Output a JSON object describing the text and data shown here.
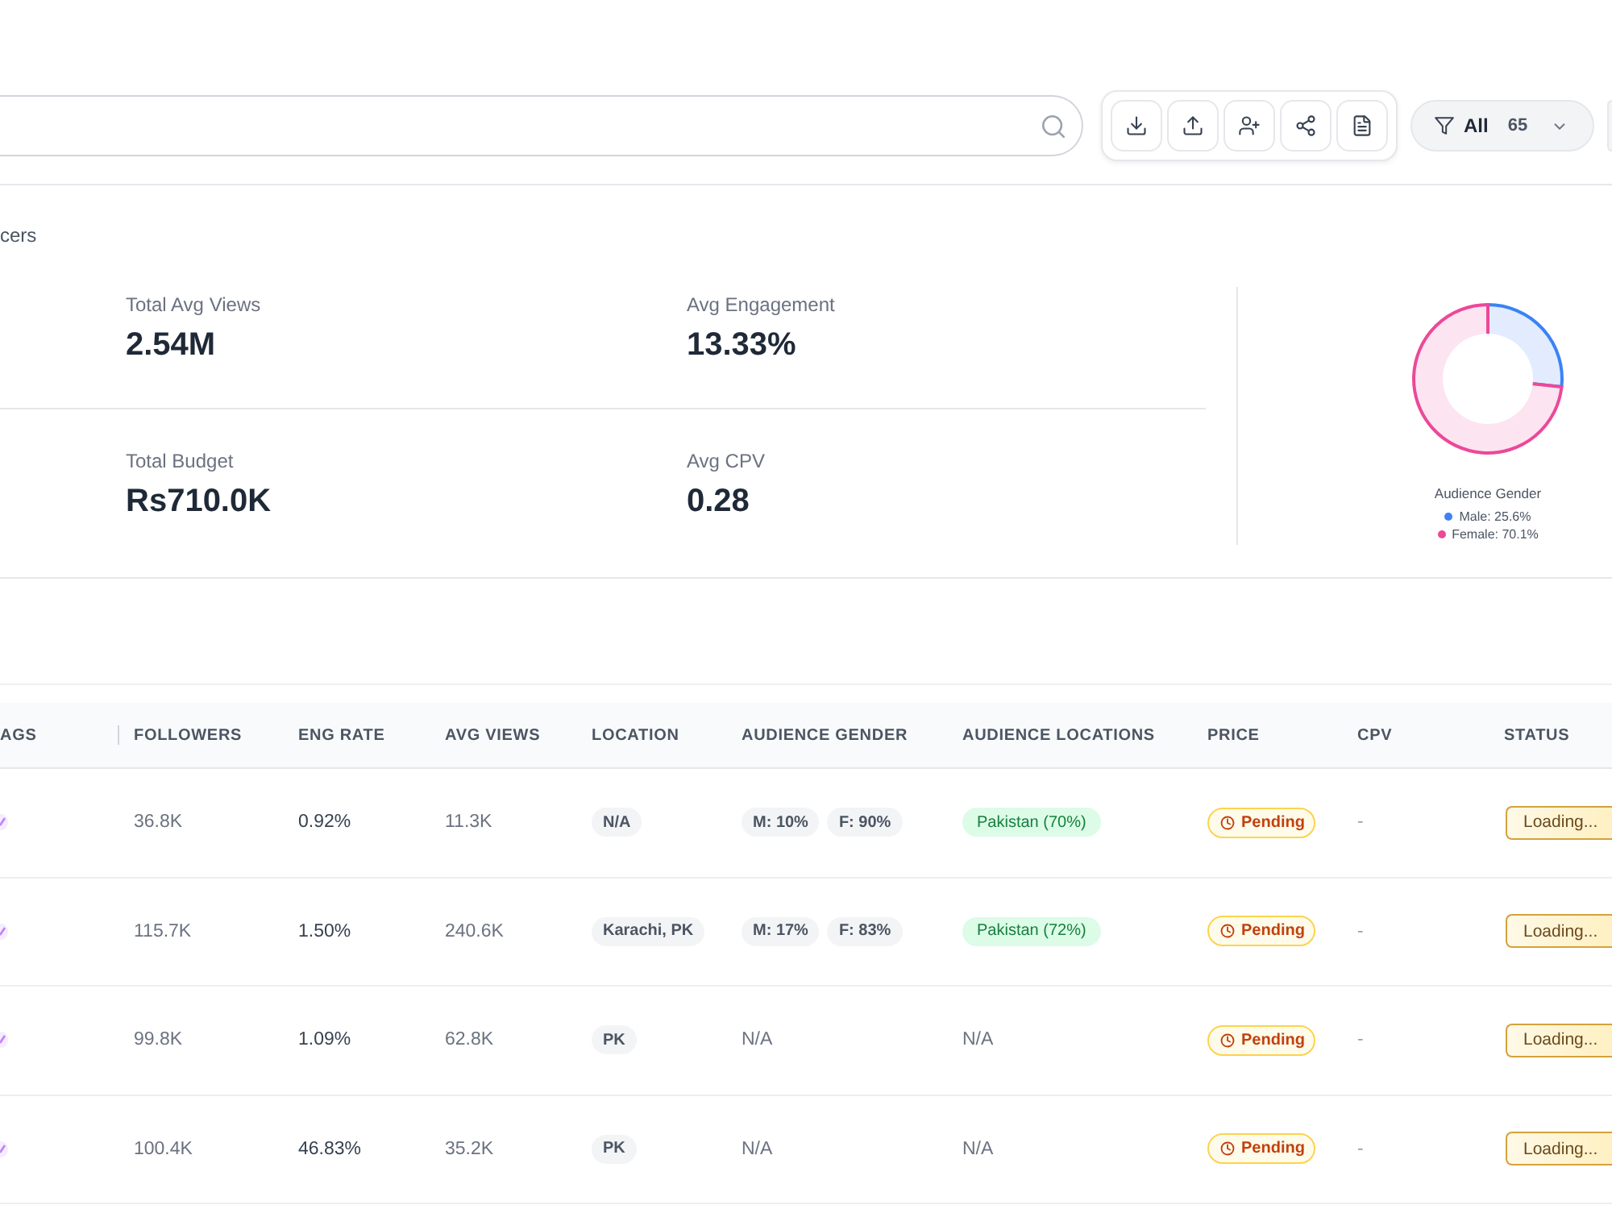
{
  "toolbar": {
    "filter": {
      "label": "All",
      "count": "65"
    }
  },
  "section_title": "cers",
  "stats": [
    {
      "label": "Total Avg Views",
      "value": "2.54M"
    },
    {
      "label": "Avg Engagement",
      "value": "13.33%"
    },
    {
      "label": "Total Budget",
      "value": "Rs710.0K"
    },
    {
      "label": "Avg CPV",
      "value": "0.28"
    }
  ],
  "gender_chart": {
    "chart_data": {
      "type": "donut",
      "title": "Audience Gender",
      "categories": [
        "Male: 25.6%",
        "Female: 70.1%"
      ],
      "values": [
        25.6,
        70.1
      ],
      "colors": [
        "#3b82f6",
        "#ec4899"
      ]
    }
  },
  "table": {
    "columns": [
      "AGS",
      "FOLLOWERS",
      "ENG RATE",
      "AVG VIEWS",
      "LOCATION",
      "AUDIENCE GENDER",
      "AUDIENCE LOCATIONS",
      "PRICE",
      "CPV",
      "STATUS"
    ],
    "rows": [
      {
        "followers": "36.8K",
        "eng_rate": "0.92%",
        "avg_views": "11.3K",
        "location": "N/A",
        "audience_gender": {
          "kind": "chips",
          "items": [
            "M: 10%",
            "F: 90%"
          ]
        },
        "audience_locations": {
          "kind": "chips",
          "items": [
            "Pakistan (70%)"
          ]
        },
        "price": "Pending",
        "cpv": "-",
        "status": "Loading..."
      },
      {
        "followers": "115.7K",
        "eng_rate": "1.50%",
        "avg_views": "240.6K",
        "location": "Karachi, PK",
        "audience_gender": {
          "kind": "chips",
          "items": [
            "M: 17%",
            "F: 83%"
          ]
        },
        "audience_locations": {
          "kind": "chips",
          "items": [
            "Pakistan (72%)"
          ]
        },
        "price": "Pending",
        "cpv": "-",
        "status": "Loading..."
      },
      {
        "followers": "99.8K",
        "eng_rate": "1.09%",
        "avg_views": "62.8K",
        "location": "PK",
        "audience_gender": {
          "kind": "text",
          "text": "N/A"
        },
        "audience_locations": {
          "kind": "text",
          "text": "N/A"
        },
        "price": "Pending",
        "cpv": "-",
        "status": "Loading..."
      },
      {
        "followers": "100.4K",
        "eng_rate": "46.83%",
        "avg_views": "35.2K",
        "location": "PK",
        "audience_gender": {
          "kind": "text",
          "text": "N/A"
        },
        "audience_locations": {
          "kind": "text",
          "text": "N/A"
        },
        "price": "Pending",
        "cpv": "-",
        "status": "Loading..."
      }
    ]
  }
}
